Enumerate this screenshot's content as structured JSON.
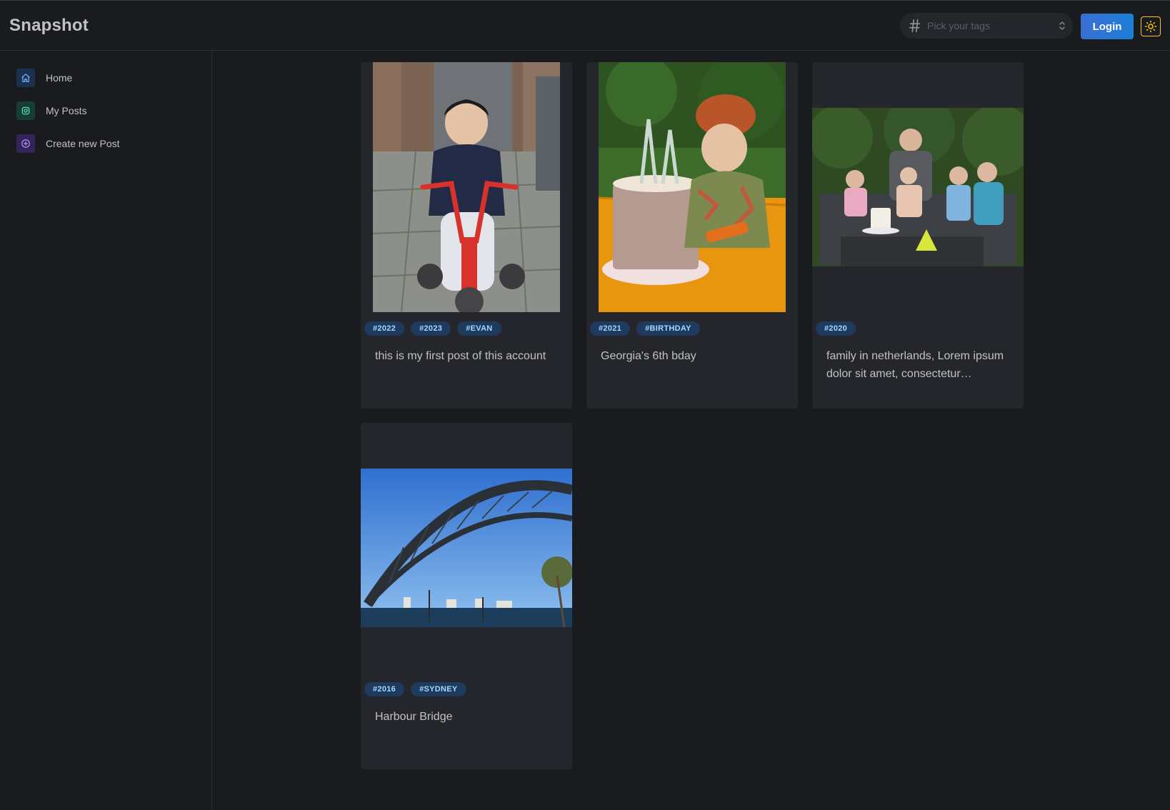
{
  "app": {
    "title": "Snapshot"
  },
  "header": {
    "tag_placeholder": "Pick your tags",
    "login_label": "Login"
  },
  "nav": {
    "items": [
      {
        "label": "Home",
        "icon": "home-icon",
        "color": "#74c0fc"
      },
      {
        "label": "My Posts",
        "icon": "instagram-icon",
        "color": "#63e6be"
      },
      {
        "label": "Create new Post",
        "icon": "plus-circle-icon",
        "color": "#b197fc"
      }
    ]
  },
  "posts": [
    {
      "tags": [
        "#2022",
        "#2023",
        "#EVAN"
      ],
      "caption": "this is my first post of this account",
      "image": "toddler on red tricycle"
    },
    {
      "tags": [
        "#2021",
        "#BIRTHDAY"
      ],
      "caption": "Georgia's 6th bday",
      "image": "girl with birthday cake"
    },
    {
      "tags": [
        "#2020"
      ],
      "caption": "family in netherlands, Lorem ipsum dolor sit amet, consectetur…",
      "image": "family photo on sofa"
    },
    {
      "tags": [
        "#2016",
        "#SYDNEY"
      ],
      "caption": "Harbour Bridge",
      "image": "Sydney Harbour Bridge"
    }
  ],
  "colors": {
    "background": "#1a1b1e",
    "card": "#25262b",
    "accent": "#1c7ed6",
    "tag_bg": "#1f3a5f",
    "tag_text": "#a5d8ff",
    "theme_icon": "#fcc419"
  }
}
